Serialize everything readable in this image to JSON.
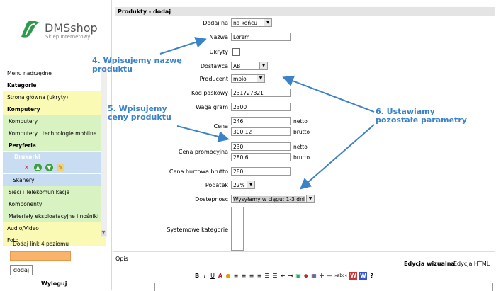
{
  "brand": {
    "name": "DMSshop",
    "tagline": "Sklep Internetowy"
  },
  "sidebar": {
    "items": [
      {
        "label": "Menu nadrzędne",
        "style": "plain"
      },
      {
        "label": "Kategorie",
        "style": "plain bold"
      },
      {
        "label": "Strona główna (ukryty)",
        "style": "yellow"
      },
      {
        "label": "Komputery",
        "style": "yellow bold"
      },
      {
        "label": "Komputery",
        "style": "green"
      },
      {
        "label": "Komputery i technologie mobilne",
        "style": "green"
      },
      {
        "label": "Peryferia",
        "style": "green bold"
      },
      {
        "label": "Skanery",
        "style": "blue"
      },
      {
        "label": "Sieci i Telekomunikacja",
        "style": "green"
      },
      {
        "label": "Komponenty",
        "style": "green"
      },
      {
        "label": "Materiały eksploatacyjne i nośniki",
        "style": "green"
      },
      {
        "label": "Audio/Video",
        "style": "yellow"
      },
      {
        "label": "Foto",
        "style": "yellow"
      }
    ],
    "selected": "Drukarki",
    "add_link_label": "Dodaj link 4 poziomu",
    "add_button": "dodaj",
    "logout": "Wyloguj"
  },
  "main": {
    "title": "Produkty - dodaj",
    "fields": {
      "dodaj_na": {
        "label": "Dodaj na",
        "value": "na końcu"
      },
      "nazwa": {
        "label": "Nazwa",
        "value": "Lorem"
      },
      "ukryty": {
        "label": "Ukryty",
        "checked": false
      },
      "dostawca": {
        "label": "Dostawca",
        "value": "AB"
      },
      "producent": {
        "label": "Producent",
        "value": "mpio"
      },
      "kod": {
        "label": "Kod paskowy",
        "value": "231727321"
      },
      "waga": {
        "label": "Waga gram",
        "value": "2300"
      },
      "cena": {
        "label": "Cena",
        "netto": "246",
        "brutto": "300.12"
      },
      "cena_promo": {
        "label": "Cena promocyjna",
        "netto": "230",
        "brutto": "280.6"
      },
      "cena_hurt": {
        "label": "Cena hurtowa brutto",
        "value": "280"
      },
      "podatek": {
        "label": "Podatek",
        "value": "22%"
      },
      "dostepnosc": {
        "label": "Dostepnosc",
        "value": "Wysyłamy w ciągu: 1-3 dni"
      },
      "syskat": {
        "label": "Systemowe kategorie"
      }
    },
    "unit_netto": "netto",
    "unit_brutto": "brutto",
    "opis_label": "Opis",
    "tab_visual": "Edycja wizualna",
    "tab_html": "Edycja HTML"
  },
  "annotations": {
    "a4_line1": "4. Wpisujemy nazwę",
    "a4_line2": "produktu",
    "a5_line1": "5. Wpisujemy",
    "a5_line2": "ceny produktu",
    "a6_line1": "6. Ustawiamy",
    "a6_line2": "pozostałe parametry"
  },
  "colors": {
    "annotation": "#3b82c8",
    "yellow": "#fafab4",
    "green": "#d9f2c2",
    "blue": "#c8ddf2",
    "orange": "#f9b46a"
  }
}
